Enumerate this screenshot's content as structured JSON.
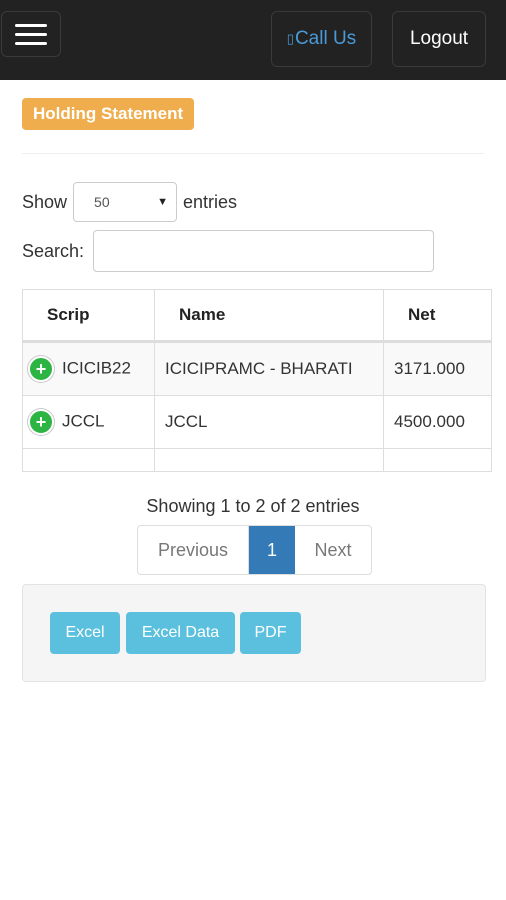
{
  "header": {
    "call_label": "Call Us",
    "call_icon": "phone-icon",
    "logout_label": "Logout"
  },
  "page": {
    "title": "Holding Statement"
  },
  "controls": {
    "show_label": "Show",
    "page_size": "50",
    "entries_label": "entries",
    "search_label": "Search:",
    "search_value": ""
  },
  "table": {
    "columns": [
      "Scrip",
      "Name",
      "Net"
    ],
    "rows": [
      {
        "scrip": "ICICIB22",
        "name": "ICICIPRAMC - BHARATI",
        "net": "3171.000"
      },
      {
        "scrip": "JCCL",
        "name": "JCCL",
        "net": "4500.000"
      }
    ]
  },
  "footer": {
    "info": "Showing 1 to 2 of 2 entries",
    "prev": "Previous",
    "page": "1",
    "next": "Next"
  },
  "export": {
    "excel": "Excel",
    "excel_data": "Excel Data",
    "pdf": "PDF"
  },
  "colors": {
    "topbar": "#222222",
    "badge": "#f0ad4e",
    "active_page": "#337ab7",
    "export_button": "#5bc0de",
    "expand_icon": "#2db543"
  }
}
